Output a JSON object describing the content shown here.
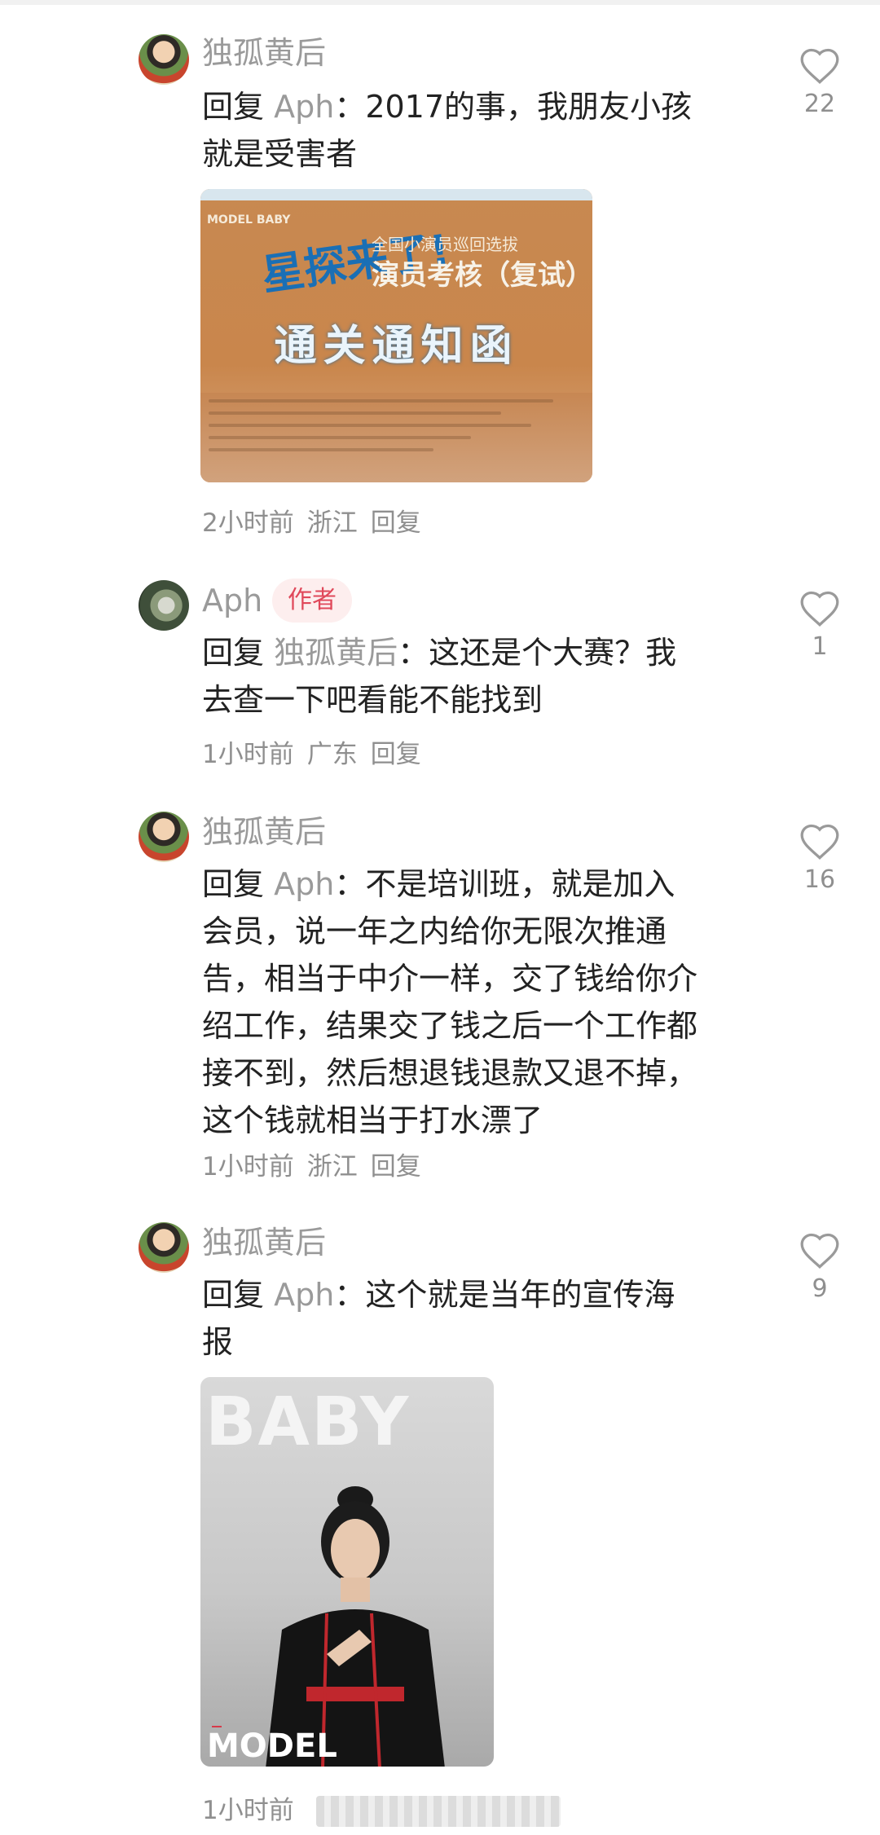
{
  "comments": [
    {
      "author": "独孤黄后",
      "reply_keyword": "回复",
      "reply_target": "Aph",
      "reply_sep": "：",
      "lines": [
        "2017的事，我朋友小孩",
        "就是受害者"
      ],
      "image": {
        "small_label": "MODEL BABY",
        "brand": "星探来了!",
        "subtitle": "全国小演员巡回选拔",
        "title": "演员考核（复试）",
        "main": "通关通知函"
      },
      "time": "2小时前",
      "location": "浙江",
      "reply_label": "回复",
      "likes": "22"
    },
    {
      "author": "Aph",
      "badge": "作者",
      "reply_keyword": "回复",
      "reply_target": "独孤黄后",
      "reply_sep": "：",
      "lines": [
        "这还是个大赛？我",
        "去查一下吧看能不能找到"
      ],
      "time": "1小时前",
      "location": "广东",
      "reply_label": "回复",
      "likes": "1"
    },
    {
      "author": "独孤黄后",
      "reply_keyword": "回复",
      "reply_target": "Aph",
      "reply_sep": "：",
      "lines": [
        "不是培训班，就是加入",
        "会员，说一年之内给你无限次推通",
        "告，相当于中介一样，交了钱给你介",
        "绍工作，结果交了钱之后一个工作都",
        "接不到，然后想退钱退款又退不掉，",
        "这个钱就相当于打水漂了"
      ],
      "time": "1小时前",
      "location": "浙江",
      "reply_label": "回复",
      "likes": "16"
    },
    {
      "author": "独孤黄后",
      "reply_keyword": "回复",
      "reply_target": "Aph",
      "reply_sep": "：",
      "lines": [
        "这个就是当年的宣传海",
        "报"
      ],
      "image": {
        "top_text": "BABY",
        "bottom_text": "MODEL"
      },
      "time": "1小时前",
      "likes": "9"
    }
  ],
  "colors": {
    "muted": "#9a9a9a",
    "text": "#222222",
    "badge_bg": "#fdeeee",
    "badge_fg": "#e0485a"
  }
}
